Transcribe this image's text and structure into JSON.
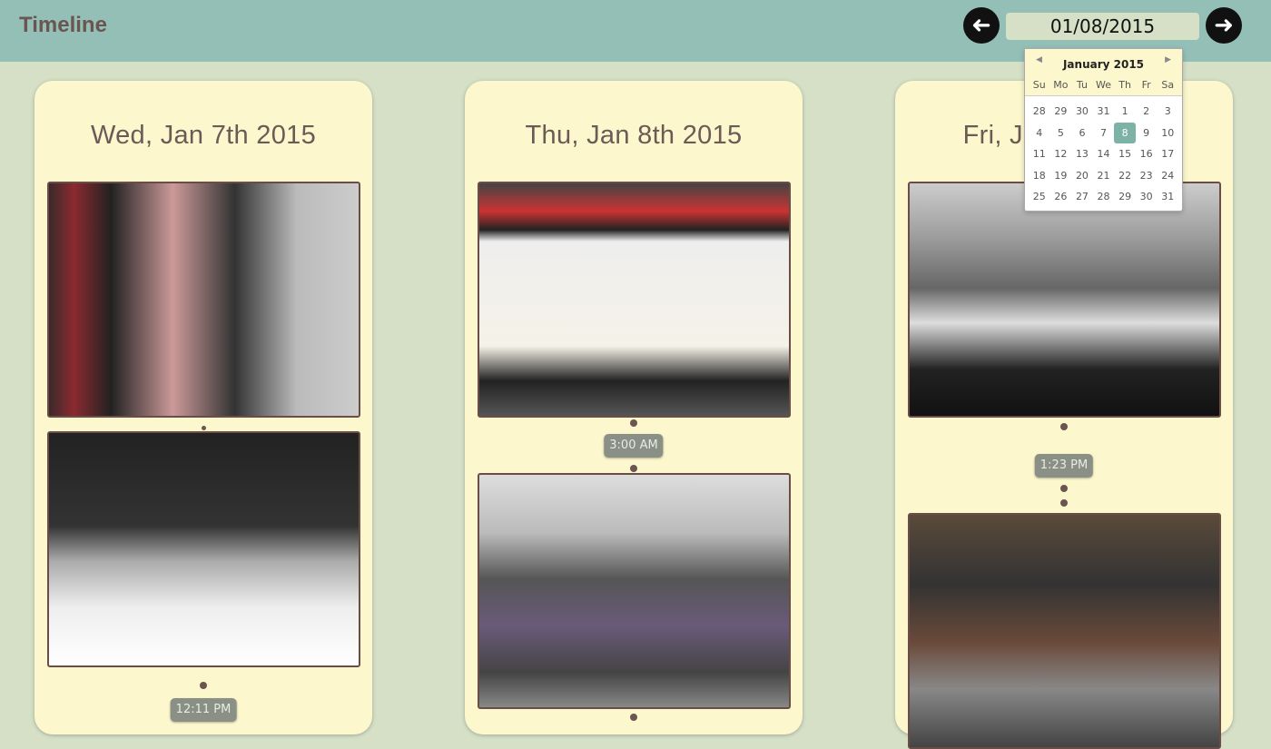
{
  "header": {
    "title": "Timeline",
    "date_value": "01/08/2015",
    "prev_icon": "arrow-left-icon",
    "next_icon": "arrow-right-icon"
  },
  "calendar": {
    "month": "January 2015",
    "weekdays": [
      "Su",
      "Mo",
      "Tu",
      "We",
      "Th",
      "Fr",
      "Sa"
    ],
    "weeks": [
      [
        "28",
        "29",
        "30",
        "31",
        "1",
        "2",
        "3"
      ],
      [
        "4",
        "5",
        "6",
        "7",
        "8",
        "9",
        "10"
      ],
      [
        "11",
        "12",
        "13",
        "14",
        "15",
        "16",
        "17"
      ],
      [
        "18",
        "19",
        "20",
        "21",
        "22",
        "23",
        "24"
      ],
      [
        "25",
        "26",
        "27",
        "28",
        "29",
        "30",
        "31"
      ]
    ],
    "selected": "8",
    "accent": "#7db2a7"
  },
  "days": [
    {
      "title": "Wed, Jan 7th 2015",
      "times": [
        "12:11 PM"
      ]
    },
    {
      "title": "Thu, Jan 8th 2015",
      "times": [
        "3:00 AM"
      ]
    },
    {
      "title": "Fri, Jan 9th 2015",
      "times": [
        "1:23 PM"
      ]
    }
  ]
}
